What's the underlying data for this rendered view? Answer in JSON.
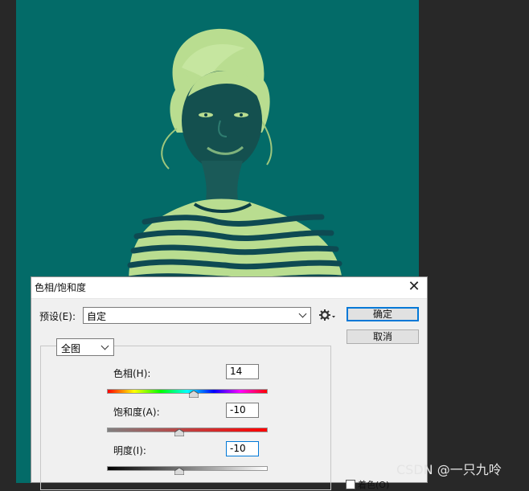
{
  "dialog": {
    "title": "色相/饱和度",
    "close_glyph": "✕",
    "preset_label": "预设(E):",
    "preset_value": "自定",
    "ok_label": "确定",
    "cancel_label": "取消",
    "channel_value": "全图",
    "hue": {
      "label": "色相(H):",
      "value": "14",
      "level": 14
    },
    "saturation": {
      "label": "饱和度(A):",
      "value": "-10",
      "level": -10
    },
    "lightness": {
      "label": "明度(I):",
      "value": "-10",
      "level": -10
    },
    "colorize_label": "着色(O)"
  },
  "watermark": "CSDN @一只九呤",
  "colors": {
    "canvas_bg": "#036b68",
    "figure": "#b9dd90",
    "shadow": "#0b3f46",
    "workspace": "#282828",
    "accent": "#0078d7"
  },
  "icons": [
    "gear-icon",
    "close-icon",
    "chevron-down-icon"
  ]
}
